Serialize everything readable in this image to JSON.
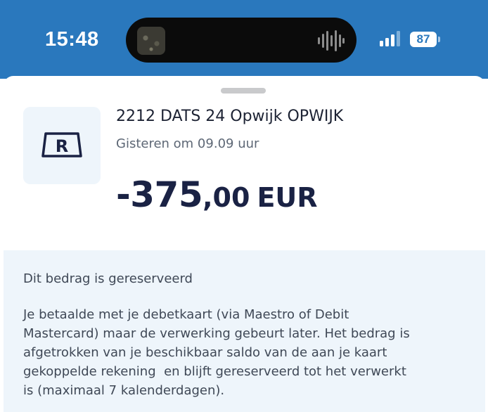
{
  "status_bar": {
    "time": "15:48",
    "battery": "87",
    "icons": [
      "media-thumbnail-icon",
      "audio-waveform-icon",
      "signal-bars-icon",
      "battery-icon"
    ]
  },
  "transaction": {
    "merchant_logo_letter": "R",
    "merchant": "2212 DATS 24 Opwijk OPWIJK",
    "date": "Gisteren om 09.09 uur",
    "amount_int": "-375",
    "amount_dec": ",00",
    "currency": "EUR"
  },
  "info": {
    "title": "Dit bedrag is gereserveerd",
    "body": "Je betaalde met je debetkaart (via Maestro of Debit\nMastercard) maar de verwerking gebeurt later. Het bedrag is\nafgetrokken van je beschikbaar saldo van de aan je kaart\ngekoppelde rekening  en blijft gereserveerd tot het verwerkt\nis (maximaal 7 kalenderdagen)."
  },
  "colors": {
    "status_bar_bg": "#2a78bd",
    "amount_text": "#1a2244",
    "info_bg": "#eef5fb"
  }
}
